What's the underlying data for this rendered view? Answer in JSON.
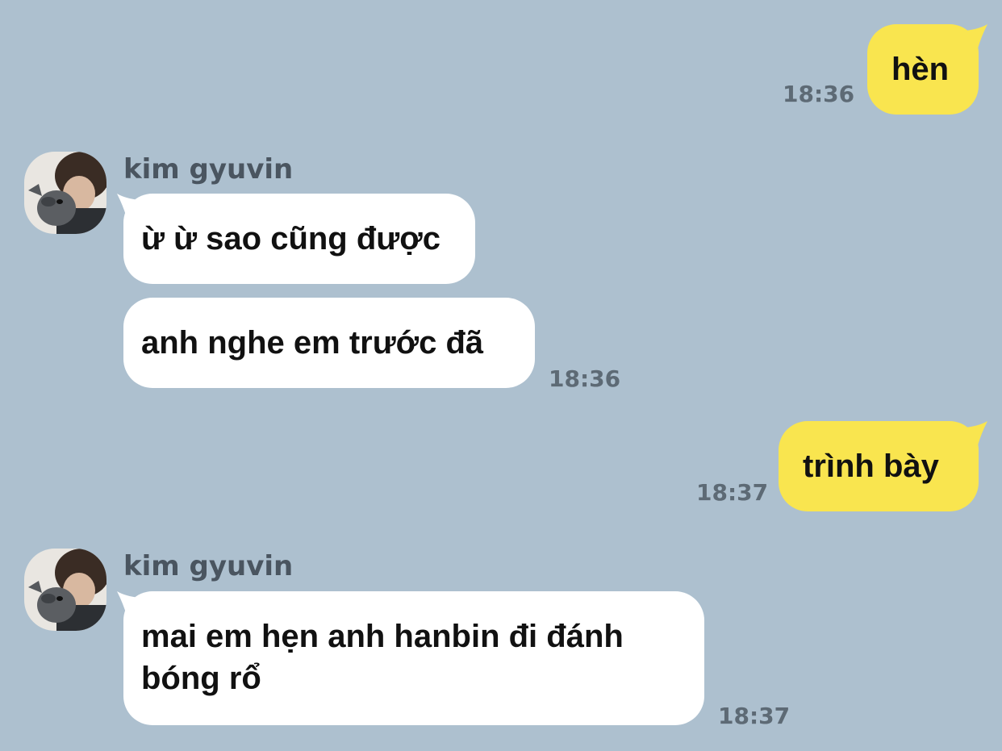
{
  "messages": [
    {
      "id": 1,
      "direction": "outgoing",
      "text": "hèn",
      "time": "18:36"
    },
    {
      "id": 2,
      "direction": "incoming",
      "sender": "kim gyuvin",
      "text": "ừ ừ sao cũng được"
    },
    {
      "id": 3,
      "direction": "incoming",
      "text": "anh nghe em trước đã",
      "time": "18:36"
    },
    {
      "id": 4,
      "direction": "outgoing",
      "text": "trình bày",
      "time": "18:37"
    },
    {
      "id": 5,
      "direction": "incoming",
      "sender": "kim gyuvin",
      "text": "mai em hẹn anh hanbin đi đánh bóng rổ",
      "time": "18:37"
    }
  ],
  "colors": {
    "background": "#adc0cf",
    "incoming_bubble": "#ffffff",
    "outgoing_bubble": "#f9e54f",
    "timestamp": "#5d6a75"
  }
}
